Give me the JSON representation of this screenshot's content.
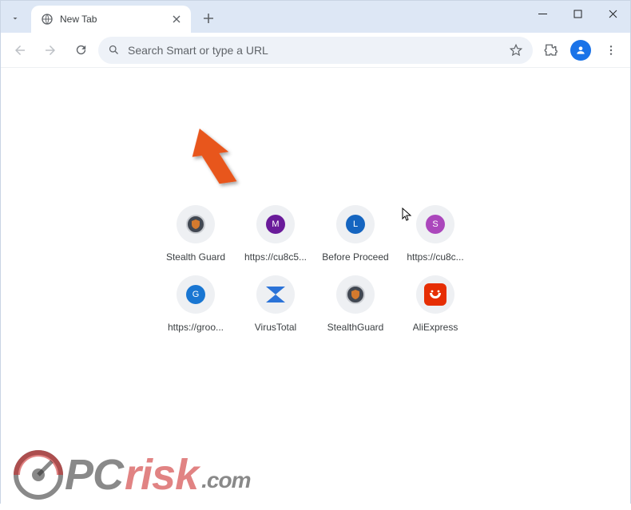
{
  "window": {
    "tab_title": "New Tab"
  },
  "toolbar": {
    "omnibox_placeholder": "Search Smart or type a URL"
  },
  "shortcuts": [
    {
      "label": "Stealth Guard",
      "icon": "shield"
    },
    {
      "label": "https://cu8c5...",
      "icon": "letter",
      "letter": "M",
      "color": "#6a1b9a"
    },
    {
      "label": "Before Proceed",
      "icon": "letter",
      "letter": "L",
      "color": "#1565c0"
    },
    {
      "label": "https://cu8c...",
      "icon": "letter",
      "letter": "S",
      "color": "#ab47bc"
    },
    {
      "label": "https://groo...",
      "icon": "letter",
      "letter": "G",
      "color": "#1976d2"
    },
    {
      "label": "VirusTotal",
      "icon": "virustotal"
    },
    {
      "label": "StealthGuard",
      "icon": "shield"
    },
    {
      "label": "AliExpress",
      "icon": "aliexpress"
    }
  ],
  "watermark": {
    "pc": "PC",
    "risk": "risk",
    "dotcom": ".com"
  }
}
